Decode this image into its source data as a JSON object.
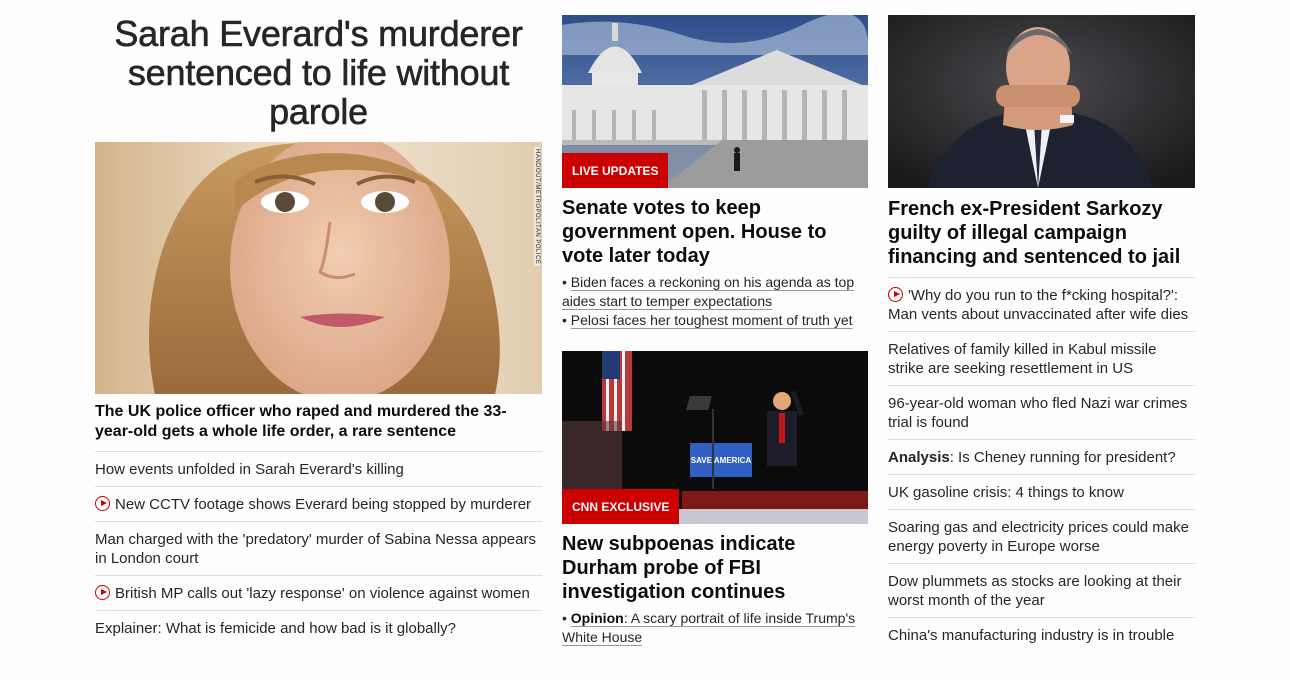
{
  "left": {
    "headline": "Sarah Everard's murderer sentenced to life without parole",
    "photo_credit": "HANDOUT/METROPOLITAN POLICE",
    "lead": "The UK police officer who raped and murdered the 33-year-old gets a whole life order, a rare sentence",
    "items": [
      {
        "text": "How events unfolded in Sarah Everard's killing",
        "video": false
      },
      {
        "text": "New CCTV footage shows Everard being stopped by murderer",
        "video": true
      },
      {
        "text": "Man charged with the 'predatory' murder of Sabina Nessa appears in London court",
        "video": false
      },
      {
        "text": "British MP calls out 'lazy response' on violence against women",
        "video": true
      },
      {
        "text": "Explainer: What is femicide and how bad is it globally?",
        "video": false
      }
    ]
  },
  "middle": {
    "card1": {
      "badge": "LIVE UPDATES",
      "title": "Senate votes to keep government open. House to vote later today",
      "bullets": [
        "Biden faces a reckoning on his agenda as top aides start to temper expectations",
        "Pelosi faces her toughest moment of truth yet"
      ]
    },
    "card2": {
      "badge": "CNN EXCLUSIVE",
      "sign_text": "SAVE AMERICA",
      "title": "New subpoenas indicate Durham probe of FBI investigation continues",
      "bullet_label": "Opinion",
      "bullet_text": ": A scary portrait of life inside Trump's White House"
    }
  },
  "right": {
    "title": "French ex-President Sarkozy guilty of illegal campaign financing and sentenced to jail",
    "items": [
      {
        "text": "'Why do you run to the f*cking hospital?': Man vents about unvaccinated after wife dies",
        "video": true
      },
      {
        "text": "Relatives of family killed in Kabul missile strike are seeking resettlement in US",
        "video": false
      },
      {
        "text": "96-year-old woman who fled Nazi war crimes trial is found",
        "video": false
      },
      {
        "label": "Analysis",
        "text": ": Is Cheney running for president?",
        "video": false
      },
      {
        "text": "UK gasoline crisis: 4 things to know",
        "video": false
      },
      {
        "text": "Soaring gas and electricity prices could make energy poverty in Europe worse",
        "video": false
      },
      {
        "text": "Dow plummets as stocks are looking at their worst month of the year",
        "video": false
      },
      {
        "text": "China's manufacturing industry is in trouble",
        "video": false
      }
    ]
  }
}
